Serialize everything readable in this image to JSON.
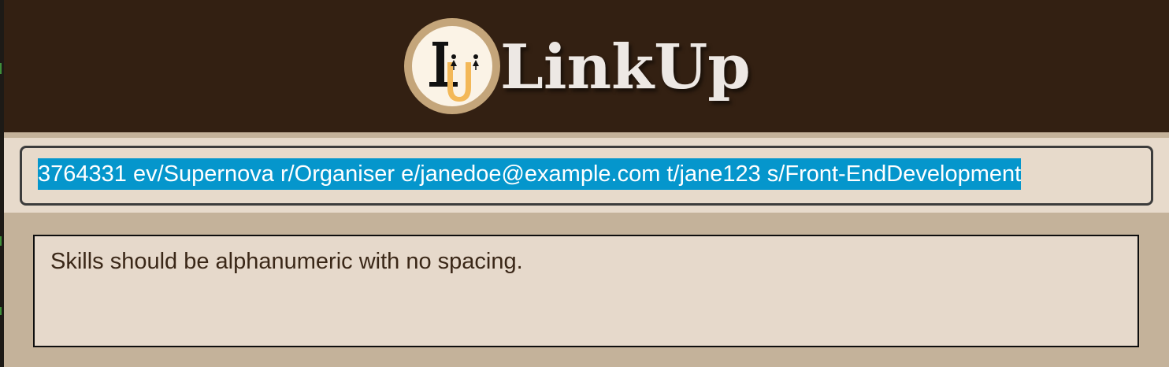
{
  "app": {
    "name": "LinkUp",
    "logo_letters": "LU"
  },
  "command_box": {
    "value": "3764331 ev/Supernova r/Organiser e/janedoe@example.com t/jane123 s/Front-EndDevelopment",
    "selected": true
  },
  "result_display": {
    "message": "Skills should be alphanumeric with no spacing."
  },
  "colors": {
    "header_background": "#332012",
    "panel_background": "#c4b29a",
    "field_background": "#e7dacb",
    "selection_highlight": "#0596cc",
    "logo_ring": "#c4a57a",
    "logo_accent": "#f3b858",
    "result_text": "#3a2717"
  },
  "icons": {
    "logo": "linkup-logo-icon"
  }
}
